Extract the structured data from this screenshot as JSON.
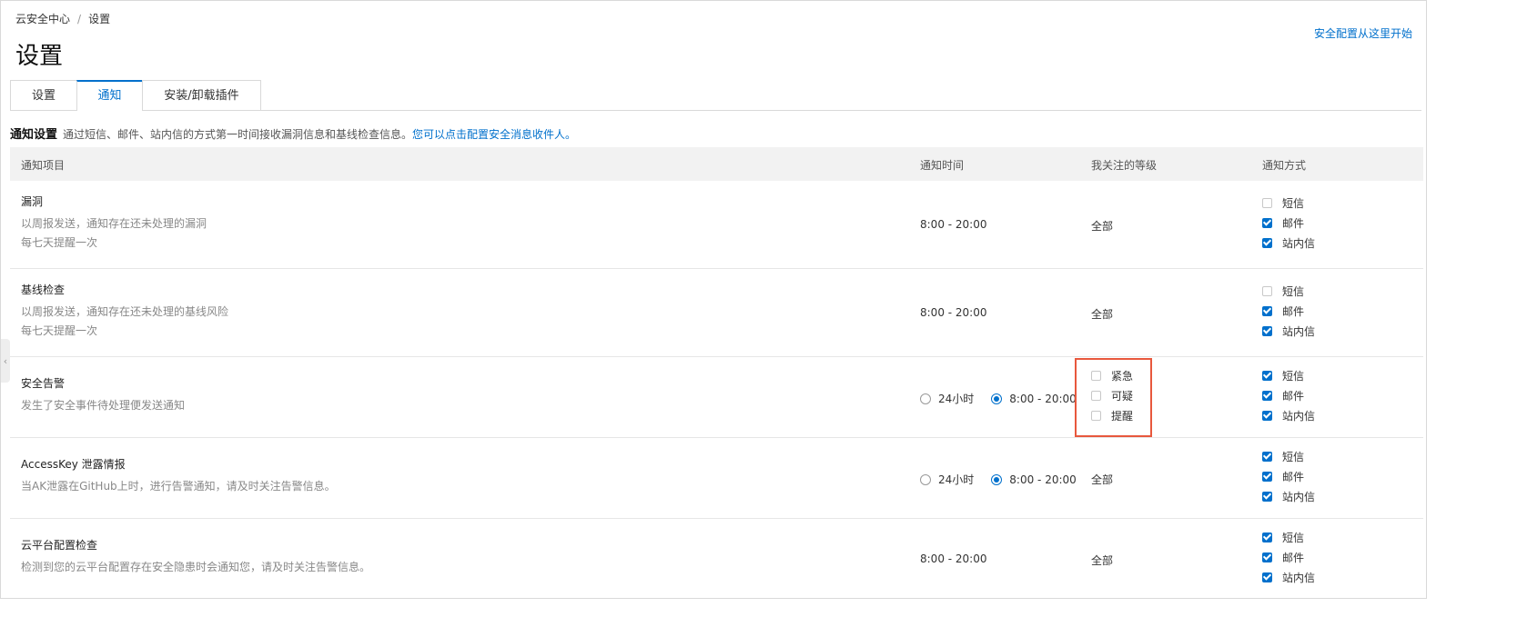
{
  "breadcrumb": {
    "parent": "云安全中心",
    "separator": "/",
    "current": "设置"
  },
  "page_title": "设置",
  "top_link": "安全配置从这里开始",
  "tabs": [
    {
      "label": "设置",
      "active": false
    },
    {
      "label": "通知",
      "active": true
    },
    {
      "label": "安装/卸载插件",
      "active": false
    }
  ],
  "section": {
    "title": "通知设置",
    "description": "通过短信、邮件、站内信的方式第一时间接收漏洞信息和基线检查信息。",
    "link": "您可以点击配置安全消息收件人。"
  },
  "table": {
    "headers": {
      "item": "通知项目",
      "time": "通知时间",
      "level": "我关注的等级",
      "method": "通知方式"
    },
    "method_labels": {
      "sms": "短信",
      "email": "邮件",
      "inbox": "站内信"
    },
    "rows": [
      {
        "title": "漏洞",
        "desc": [
          "以周报发送，通知存在还未处理的漏洞",
          "每七天提醒一次"
        ],
        "time": "8:00 - 20:00",
        "level": "全部",
        "sms": false,
        "email": true,
        "inbox": true
      },
      {
        "title": "基线检查",
        "desc": [
          "以周报发送，通知存在还未处理的基线风险",
          "每七天提醒一次"
        ],
        "time": "8:00 - 20:00",
        "level": "全部",
        "sms": false,
        "email": true,
        "inbox": true
      },
      {
        "title": "安全告警",
        "desc": [
          "发生了安全事件待处理便发送通知"
        ],
        "time_options": [
          "24小时",
          "8:00 - 20:00"
        ],
        "time_selected": 1,
        "levels": [
          {
            "label": "紧急",
            "checked": false
          },
          {
            "label": "可疑",
            "checked": false
          },
          {
            "label": "提醒",
            "checked": false
          }
        ],
        "sms": true,
        "email": true,
        "inbox": true
      },
      {
        "title": "AccessKey 泄露情报",
        "desc": [
          "当AK泄露在GitHub上时，进行告警通知，请及时关注告警信息。"
        ],
        "time_options": [
          "24小时",
          "8:00 - 20:00"
        ],
        "time_selected": 1,
        "level": "全部",
        "sms": true,
        "email": true,
        "inbox": true
      },
      {
        "title": "云平台配置检查",
        "desc": [
          "检测到您的云平台配置存在安全隐患时会通知您，请及时关注告警信息。"
        ],
        "time": "8:00 - 20:00",
        "level": "全部",
        "sms": true,
        "email": true,
        "inbox": true
      }
    ]
  },
  "colors": {
    "accent": "#0070cc",
    "highlight": "#e8583d",
    "header_bg": "#f2f2f2"
  }
}
